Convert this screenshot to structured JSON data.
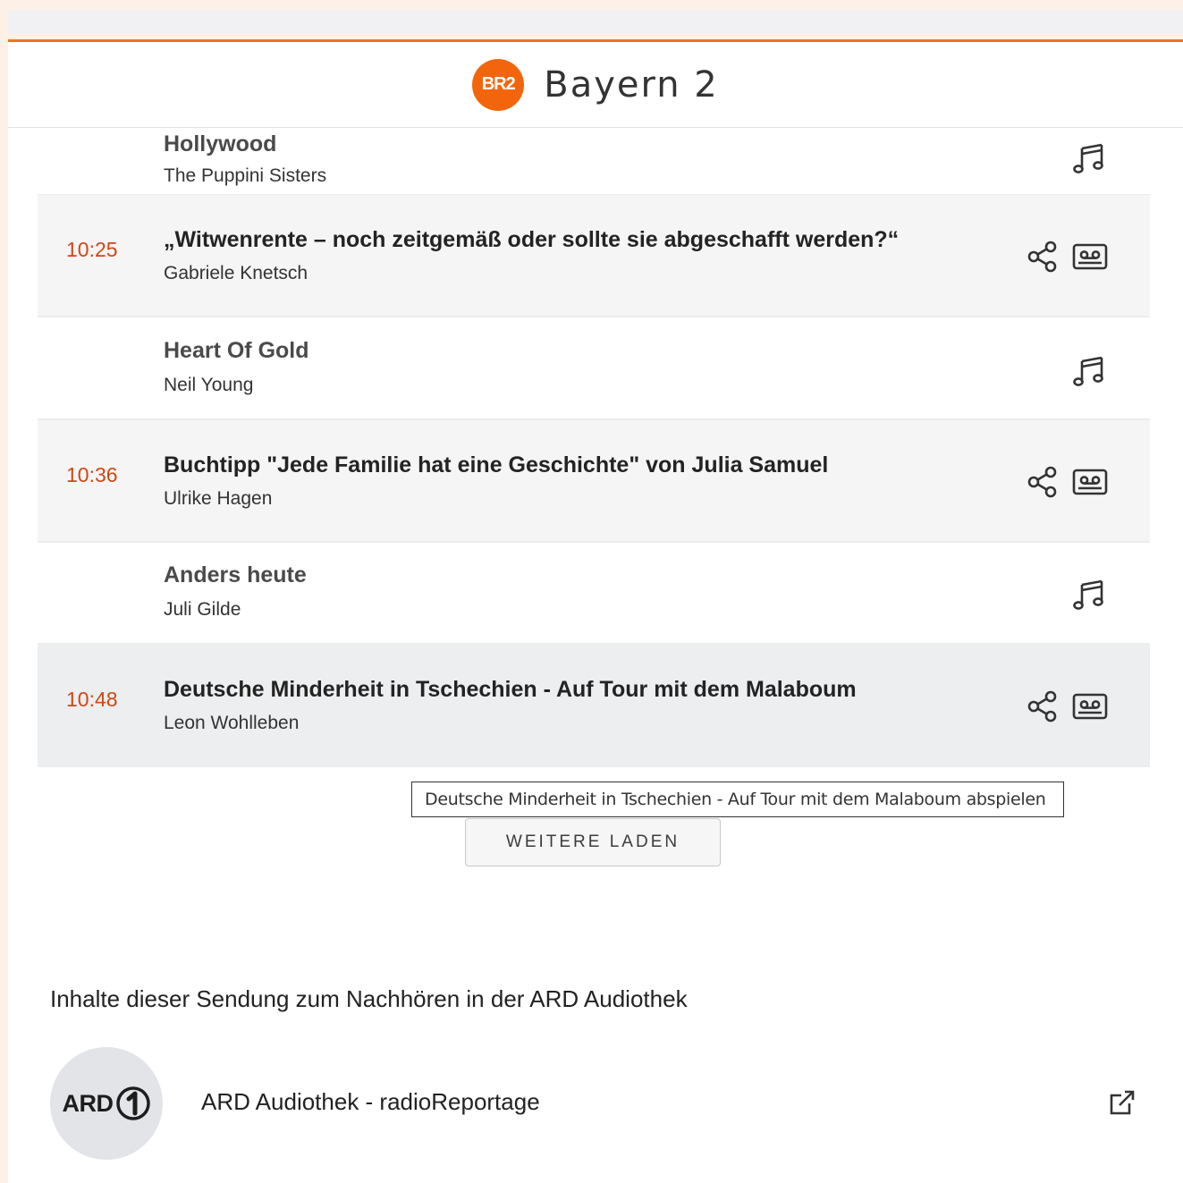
{
  "header": {
    "logo_text": "BR2",
    "station_name": "Bayern 2"
  },
  "playlist": [
    {
      "type": "music",
      "time": "",
      "title": "Hollywood",
      "subtitle": "The Puppini Sisters"
    },
    {
      "type": "show",
      "time": "10:25",
      "title": "„Witwenrente – noch zeitgemäß oder sollte sie abgeschafft werden?“",
      "subtitle": "Gabriele Knetsch"
    },
    {
      "type": "music",
      "time": "",
      "title": "Heart Of Gold",
      "subtitle": "Neil Young"
    },
    {
      "type": "show",
      "time": "10:36",
      "title": "Buchtipp \"Jede Familie hat eine Geschichte\" von Julia Samuel",
      "subtitle": "Ulrike Hagen"
    },
    {
      "type": "music",
      "time": "",
      "title": "Anders heute",
      "subtitle": "Juli Gilde"
    },
    {
      "type": "show",
      "time": "10:48",
      "title": "Deutsche Minderheit in Tschechien - Auf Tour mit dem Malaboum",
      "subtitle": "Leon Wohlleben"
    }
  ],
  "tooltip": "Deutsche Minderheit in Tschechien - Auf Tour mit dem Malaboum abspielen",
  "load_more_label": "WEITERE LADEN",
  "audiothek": {
    "section_title": "Inhalte dieser Sendung zum Nachhören in der ARD Audiothek",
    "logo_text": "ARD",
    "link_label": "ARD Audiothek - radioReportage"
  },
  "icons": {
    "music": "music-note-icon",
    "share": "share-icon",
    "play": "cassette-icon",
    "external": "external-link-icon",
    "ard": "ard-one-icon"
  },
  "colors": {
    "accent": "#f3650c",
    "time": "#d24613",
    "background": "#fdf0e6"
  }
}
